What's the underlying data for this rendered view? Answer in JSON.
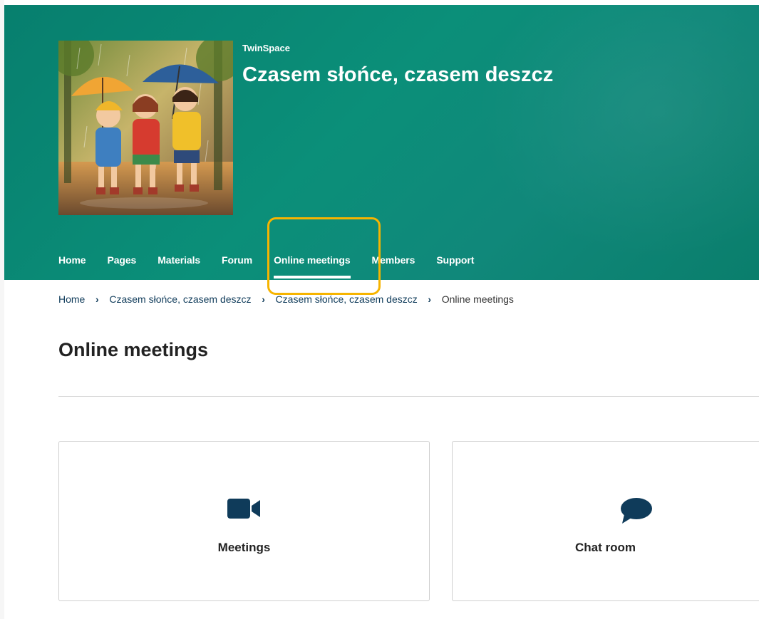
{
  "header": {
    "eyebrow": "TwinSpace",
    "title": "Czasem słońce, czasem deszcz"
  },
  "nav": {
    "items": [
      {
        "label": "Home"
      },
      {
        "label": "Pages"
      },
      {
        "label": "Materials"
      },
      {
        "label": "Forum"
      },
      {
        "label": "Online meetings",
        "active": true
      },
      {
        "label": "Members"
      },
      {
        "label": "Support"
      }
    ]
  },
  "breadcrumb": {
    "items": [
      "Home",
      "Czasem słońce, czasem deszcz",
      "Czasem słońce, czasem deszcz",
      "Online meetings"
    ]
  },
  "main": {
    "title": "Online meetings",
    "cards": [
      {
        "label": "Meetings",
        "icon": "video-camera-icon"
      },
      {
        "label": "Chat room",
        "icon": "chat-bubble-icon"
      }
    ]
  },
  "colors": {
    "banner": "#0b8a75",
    "icon": "#0f3b5a",
    "highlight": "#f6b400"
  }
}
